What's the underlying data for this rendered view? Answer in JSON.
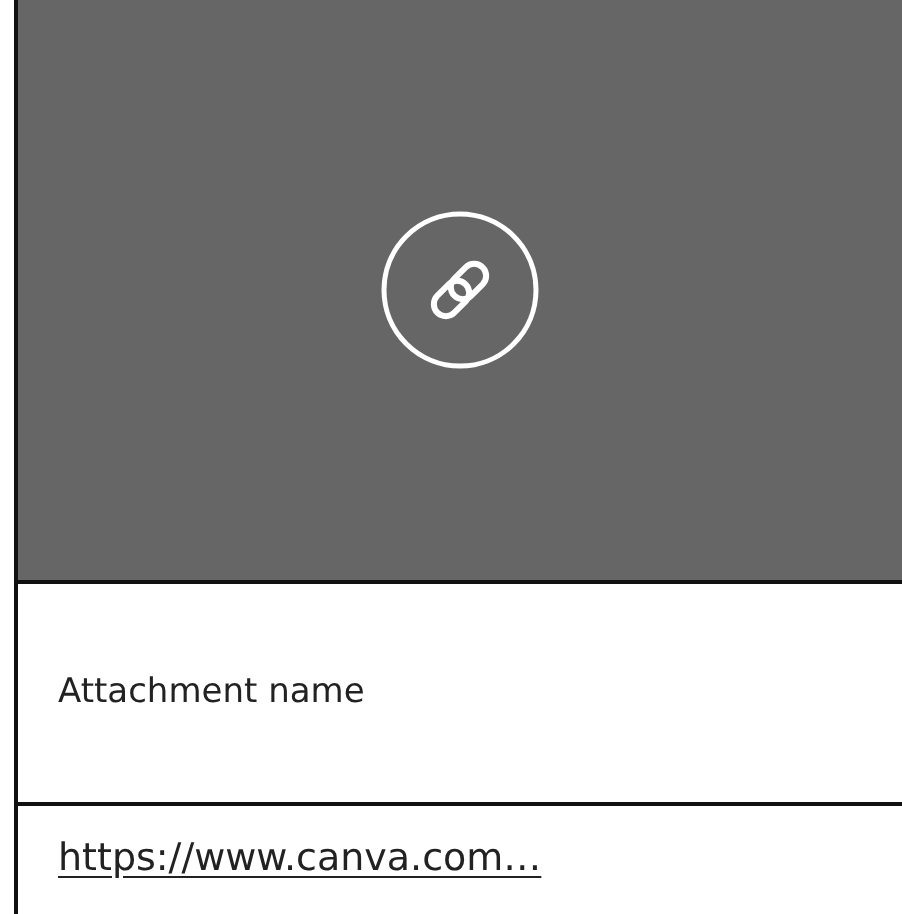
{
  "attachment": {
    "name": "Attachment name",
    "url": "https://www.canva.com…"
  }
}
